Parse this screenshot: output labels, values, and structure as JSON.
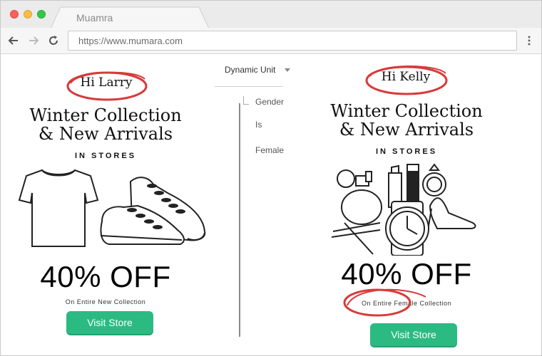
{
  "browser": {
    "tab_title": "Muamra",
    "url": "https://www.mumara.com",
    "back_icon": "back-arrow-icon",
    "forward_icon": "forward-arrow-icon",
    "reload_icon": "reload-icon",
    "menu_icon": "kebab-menu-icon"
  },
  "colors": {
    "cta": "#2cba83",
    "circle_highlight": "#d83a3a",
    "traffic_red": "#fc605b",
    "traffic_yellow": "#fdbc40",
    "traffic_green": "#34c84a"
  },
  "left_email": {
    "greeting": "Hi Larry",
    "headline_line1": "Winter Collection",
    "headline_line2": "& New Arrivals",
    "subhead": "IN STORES",
    "offer": "40% OFF",
    "fine_print": "On Entire New Collection",
    "button": "Visit Store",
    "illustration": "tshirt-and-sneakers-illustration"
  },
  "right_email": {
    "greeting": "Hi Kelly",
    "headline_line1": "Winter Collection",
    "headline_line2": "& New Arrivals",
    "subhead": "IN STORES",
    "offer": "40% OFF",
    "fine_print": "On Entire Female Collection",
    "button": "Visit Store",
    "illustration": "perfume-lipstick-watch-ring-heels-illustration"
  },
  "dynamic_unit": {
    "label": "Dynamic Unit",
    "rule": {
      "field": "Gender",
      "operator": "Is",
      "value": "Female"
    }
  }
}
